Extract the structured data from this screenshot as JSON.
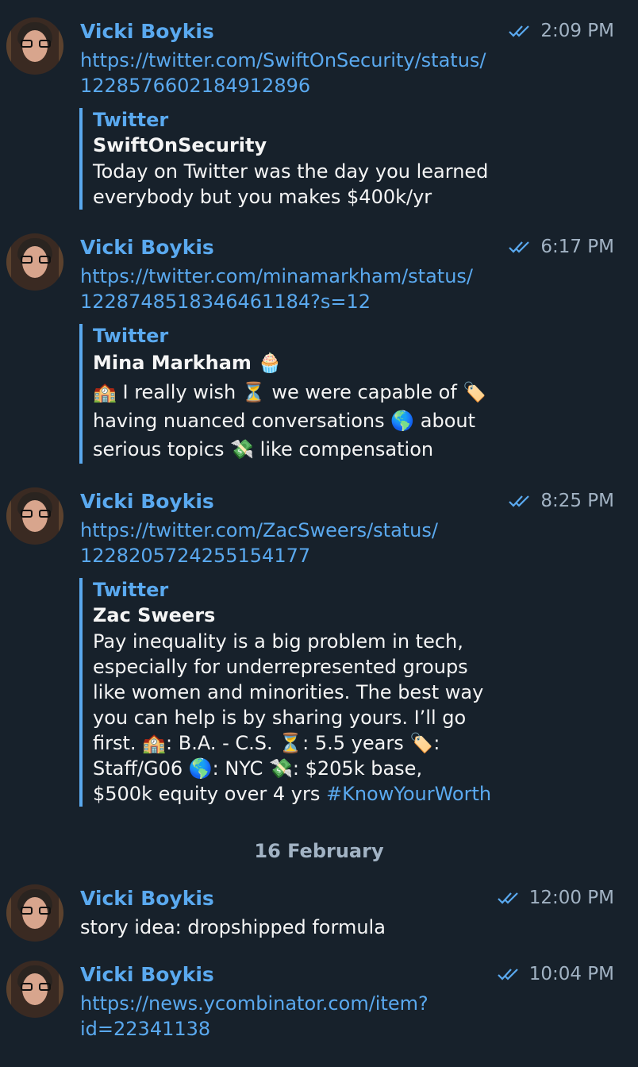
{
  "messages": [
    {
      "sender": "Vicki Boykis",
      "time": "2:09 PM",
      "link_lines": [
        "https://twitter.com/SwiftOnSecurity/status/",
        "1228576602184912896"
      ],
      "preview": {
        "site": "Twitter",
        "author": "SwiftOnSecurity",
        "body_lines": [
          "Today on Twitter was the day you learned",
          "everybody but you makes $400k/yr"
        ]
      }
    },
    {
      "sender": "Vicki Boykis",
      "time": "6:17 PM",
      "link_lines": [
        "https://twitter.com/minamarkham/status/",
        "1228748518346461184?s=12"
      ],
      "preview": {
        "site": "Twitter",
        "author": "Mina Markham 🧁",
        "body_lines": [
          "🏫 I really wish ⏳ we were capable of 🏷️",
          "having nuanced conversations 🌎 about",
          "serious topics 💸 like compensation"
        ]
      }
    },
    {
      "sender": "Vicki Boykis",
      "time": "8:25 PM",
      "link_lines": [
        "https://twitter.com/ZacSweers/status/",
        "1228205724255154177"
      ],
      "preview": {
        "site": "Twitter",
        "author": "Zac Sweers",
        "body_lines": [
          "Pay inequality is a big problem in tech,",
          "especially for underrepresented groups",
          "like women and minorities. The best way",
          "you can help is by sharing yours. I’ll go",
          "first. 🏫: B.A. - C.S. ⏳: 5.5 years 🏷️:",
          "Staff/G06 🌎: NYC 💸: $205k base,"
        ],
        "last_line_text": "$500k equity over 4 yrs ",
        "hashtag": "#KnowYourWorth"
      }
    },
    {
      "sender": "Vicki Boykis",
      "time": "12:00 PM",
      "text": "story idea: dropshipped formula"
    },
    {
      "sender": "Vicki Boykis",
      "time": "10:04 PM",
      "link_lines": [
        "https://news.ycombinator.com/item?",
        "id=22341138"
      ]
    }
  ],
  "date_separator": "16 February",
  "colors": {
    "background": "#17212b",
    "accent": "#5aa9ef",
    "muted": "#a2b3c4"
  },
  "icons": {
    "read_status": "double-check-icon",
    "avatar": "user-avatar"
  }
}
